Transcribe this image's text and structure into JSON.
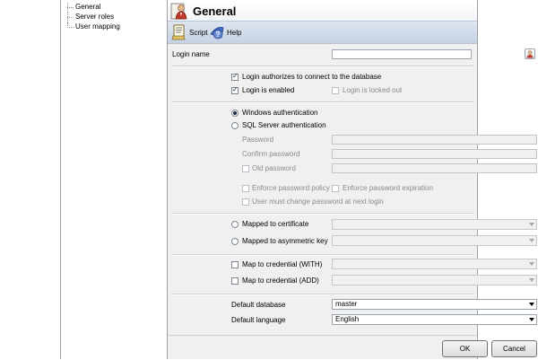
{
  "sidebar": {
    "items": [
      {
        "label": "General"
      },
      {
        "label": "Server roles"
      },
      {
        "label": "User mapping"
      }
    ]
  },
  "header": {
    "title": "General",
    "icon": "user-icon"
  },
  "toolbar": {
    "script_label": "Script",
    "help_label": "Help"
  },
  "form": {
    "login_name_label": "Login name",
    "login_name_value": "",
    "authorize_label": "Login authorizes to connect to the database",
    "authorize_checked": true,
    "enabled_label": "Login is enabled",
    "enabled_checked": true,
    "locked_label": "Login is locked out",
    "locked_checked": false,
    "windows_auth_label": "Windows authentication",
    "sql_auth_label": "SQL Server authentication",
    "selected_auth": "windows",
    "password_label": "Password",
    "confirm_password_label": "Confirm password",
    "old_password_label": "Old password",
    "enforce_policy_label": "Enforce password policy",
    "enforce_expiration_label": "Enforce password expiration",
    "must_change_label": "User must change password at next login",
    "mapped_cert_label": "Mapped to certificate",
    "mapped_key_label": "Mapped to asymmetric key",
    "map_with_label": "Map to credential (WITH)",
    "map_add_label": "Map to credential (ADD)",
    "default_db_label": "Default database",
    "default_db_value": "master",
    "default_lang_label": "Default language",
    "default_lang_value": "English"
  },
  "footer": {
    "ok_label": "OK",
    "cancel_label": "Cancel"
  }
}
